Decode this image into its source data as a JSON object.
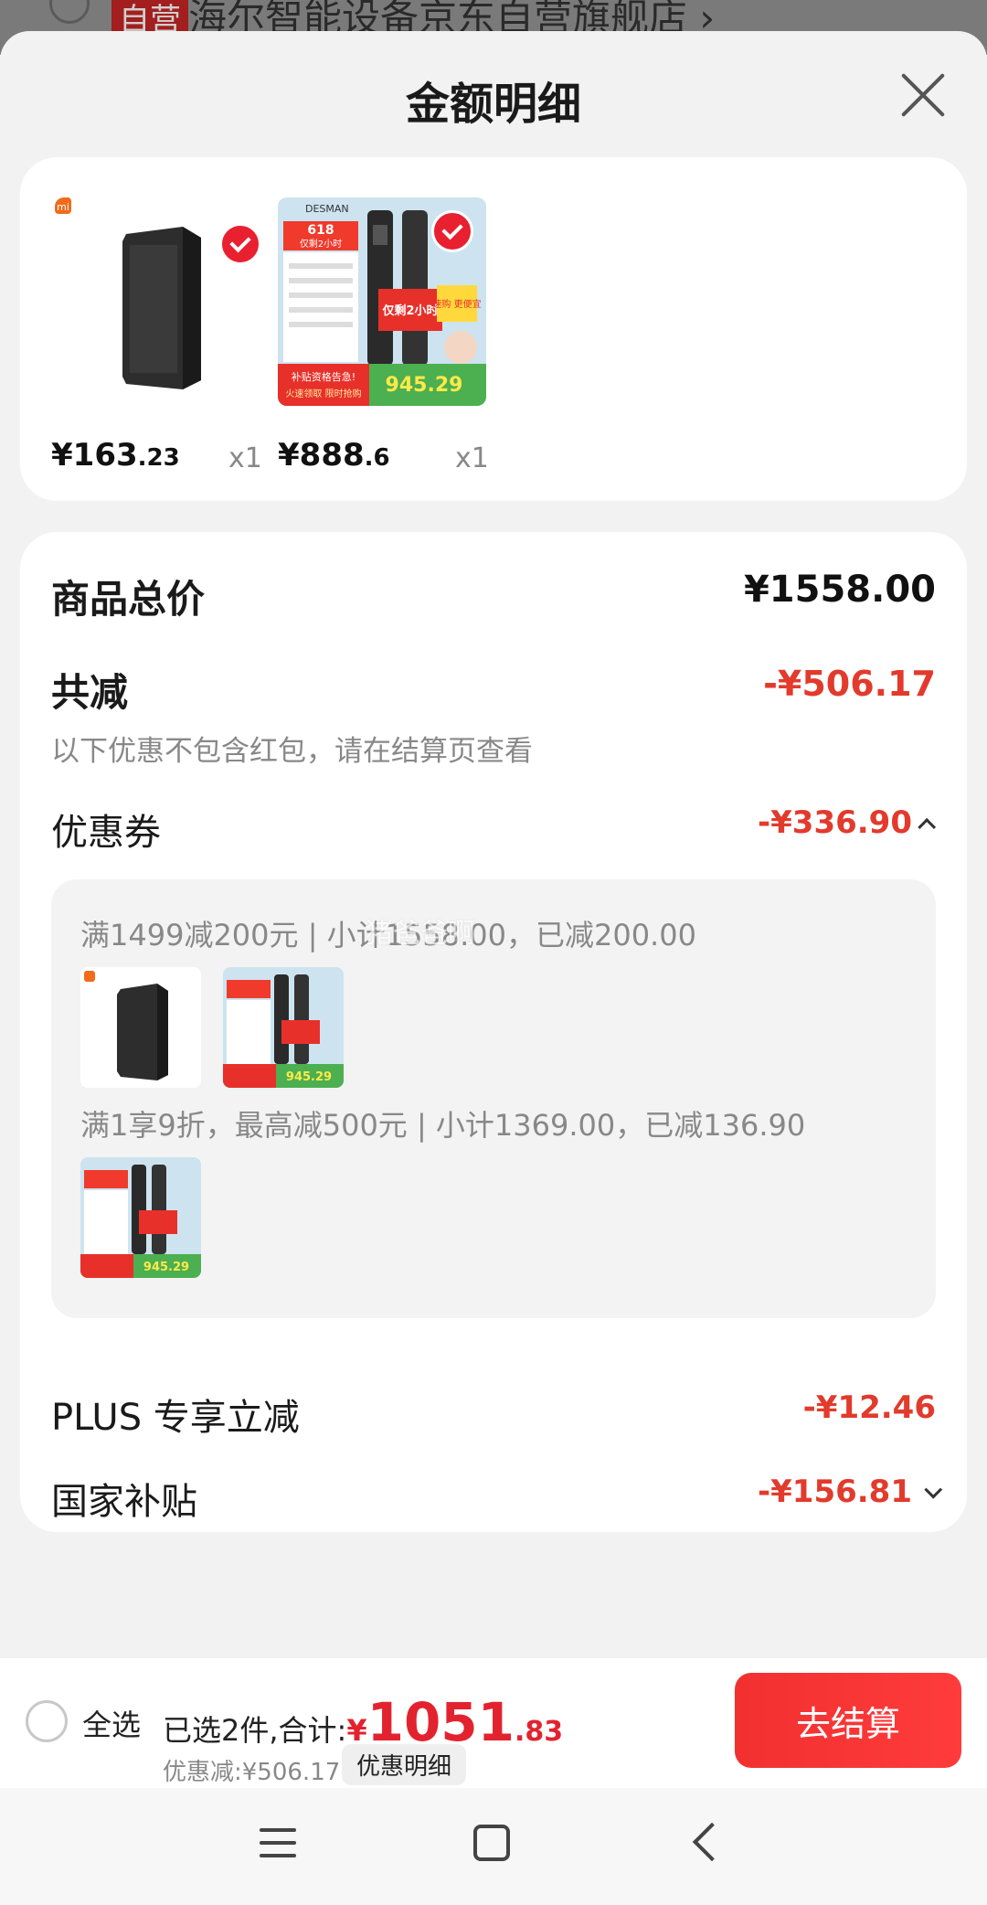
{
  "background": {
    "store_tag": "自营",
    "store_name": "海尔智能设备京东自营旗舰店 ›"
  },
  "sheet": {
    "title": "金额明细"
  },
  "products": [
    {
      "brand_logo": "xiaomi-logo",
      "price_int": "¥163",
      "price_dec": ".23",
      "qty": "x1",
      "image": "black-router-box",
      "selected": true
    },
    {
      "brand_logo": "desman-logo",
      "price_int": "¥888",
      "price_dec": ".6",
      "qty": "x1",
      "image": "smart-door-lock-promo",
      "selected": true
    }
  ],
  "promo_image_text": {
    "brand": "DESMAN",
    "badge": "618",
    "badge_sub": "仅剩2小时",
    "headline": "仅剩2小时",
    "tag": "速购 更便宜",
    "price": "945.29",
    "sub_left": "补贴资格告急!",
    "sub_left2": "火速领取 限时抢购"
  },
  "details": {
    "total_label": "商品总价",
    "total_value": "¥1558.00",
    "reduce_label": "共减",
    "reduce_value": "-¥506.17",
    "reduce_note": "以下优惠不包含红包，请在结算页查看",
    "coupon_label": "优惠券",
    "coupon_value": "-¥336.90",
    "coupon_rule_1": "满1499减200元 | 小计1558.00，已减200.00",
    "coupon_rule_2": "满1享9折，最高减500元 | 小计1369.00，已减136.90",
    "plus_label": "PLUS 专享立减",
    "plus_value": "-¥12.46",
    "subsidy_label": "国家补贴",
    "subsidy_value": "-¥156.81",
    "watermark": "猪爸爸啊"
  },
  "bottom": {
    "select_all": "全选",
    "summary_prefix": "已选2件,合计:",
    "total_symbol": "¥",
    "total_int": "1051",
    "total_dec": ".83",
    "discount_line": "优惠减:¥506.17",
    "detail_chip": "优惠明细",
    "checkout": "去结算"
  },
  "colors": {
    "accent_red": "#e2232f",
    "discount_red": "#e23a2c"
  }
}
